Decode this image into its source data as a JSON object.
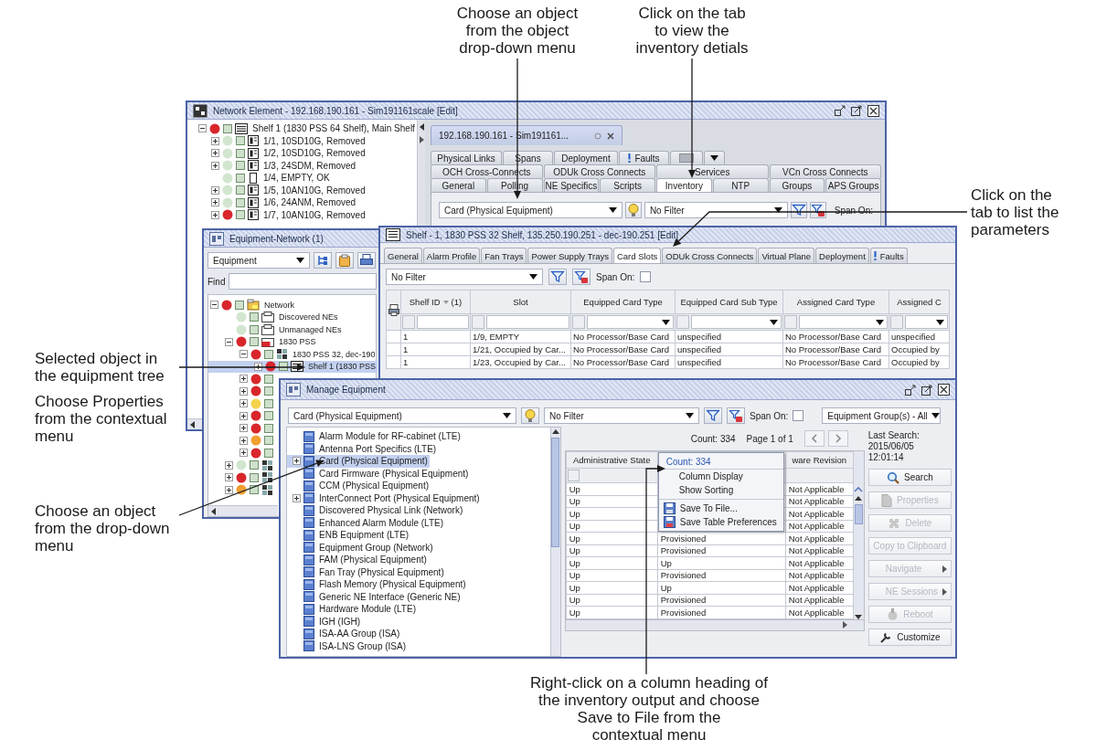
{
  "callouts": [
    {
      "lines": [
        "Choose an object",
        "from the object",
        "drop-down menu"
      ]
    },
    {
      "lines": [
        "Click on the tab",
        "to view the",
        "inventory detials"
      ]
    },
    {
      "lines": [
        "Click on the",
        "tab to list the",
        "parameters"
      ]
    },
    {
      "lines": [
        "Selected object in",
        "the equipment tree"
      ]
    },
    {
      "lines": [
        "Choose Properties",
        "from the contextual",
        "menu"
      ]
    },
    {
      "lines": [
        "Choose an object",
        "from the drop-down",
        "menu"
      ]
    },
    {
      "lines": [
        "Right-click on a column heading of",
        "the inventory output and choose",
        "Save to File from the",
        "contextual menu"
      ]
    }
  ],
  "network_element_window": {
    "title": "Network Element - 192.168.190.161 - Sim191161scale [Edit]",
    "tree": [
      {
        "label": "Shelf 1 (1830 PSS 64 Shelf), Main Shelf",
        "color": "#d8262b",
        "kind": "shelf",
        "expanded": true,
        "children": [
          {
            "label": "1/1, 10SD10G, Removed",
            "color": "#d2e6cf",
            "kind": "card",
            "expanded": false
          },
          {
            "label": "1/2, 10SD10G, Removed",
            "color": "#d2e6cf",
            "kind": "card",
            "expanded": false
          },
          {
            "label": "1/3, 24SDM, Removed",
            "color": "#d2e6cf",
            "kind": "card",
            "expanded": false
          },
          {
            "label": "1/4, EMPTY, OK",
            "color": "#d2e6cf",
            "kind": "slot"
          },
          {
            "label": "1/5, 10AN10G, Removed",
            "color": "#d2e6cf",
            "kind": "card",
            "expanded": false
          },
          {
            "label": "1/6, 24ANM, Removed",
            "color": "#d2e6cf",
            "kind": "card",
            "expanded": false
          },
          {
            "label": "1/7, 10AN10G, Removed",
            "color": "#d8262b",
            "kind": "card",
            "expanded": false
          }
        ]
      }
    ],
    "document_tab": "192.168.190.161 - Sim191161...",
    "tab_rows": [
      [
        {
          "label": "Physical Links",
          "selected": false,
          "kind": "text"
        },
        {
          "label": "Spans",
          "selected": false,
          "kind": "text"
        },
        {
          "label": "Deployment",
          "selected": false,
          "kind": "text"
        },
        {
          "label": "Faults",
          "selected": false,
          "kind": "alert"
        },
        {
          "selected": false,
          "kind": "icon"
        }
      ],
      [
        {
          "label": "OCH Cross-Connects",
          "selected": false,
          "kind": "text"
        },
        {
          "label": "ODUk Cross Connects",
          "selected": false,
          "kind": "text"
        },
        {
          "label": "Services",
          "selected": false,
          "kind": "text"
        },
        {
          "label": "VCn Cross Connects",
          "selected": false,
          "kind": "text"
        }
      ],
      [
        {
          "label": "General",
          "selected": false,
          "kind": "text"
        },
        {
          "label": "Polling",
          "selected": false,
          "kind": "text"
        },
        {
          "label": "NE Specifics",
          "selected": false,
          "kind": "text"
        },
        {
          "label": "Scripts",
          "selected": false,
          "kind": "text"
        },
        {
          "label": "Inventory",
          "selected": true,
          "kind": "text"
        },
        {
          "label": "NTP",
          "selected": false,
          "kind": "text"
        },
        {
          "label": "Groups",
          "selected": false,
          "kind": "text"
        },
        {
          "label": "APS Groups",
          "selected": false,
          "kind": "text"
        }
      ]
    ],
    "overflow_menu": true,
    "object_combo": "Card (Physical Equipment)",
    "filter_combo": "No Filter",
    "span_on_label": "Span On:"
  },
  "equipment_network_window": {
    "title": "Equipment-Network (1)",
    "view_combo": "Equipment",
    "find_label": "Find",
    "tree": [
      {
        "label": "Network",
        "color": "#d8262b",
        "kind": "network",
        "expanded": true,
        "selected": false,
        "children": [
          {
            "label": "Discovered NEs",
            "color": "#d2e6cf",
            "kind": "group",
            "selected": false
          },
          {
            "label": "Unmanaged NEs",
            "color": "#d2e6cf",
            "kind": "group",
            "selected": false
          },
          {
            "label": "1830 PSS",
            "color": "#d8262b",
            "kind": "ne",
            "expanded": true,
            "selected": false,
            "children": [
              {
                "label": "1830 PSS 32, dec-190",
                "color": "#d8262b",
                "kind": "node",
                "expanded": true,
                "selected": false,
                "children": [
                  {
                    "label": "Shelf 1 (1830 PSS",
                    "color": "#d8262b",
                    "kind": "shelf",
                    "expanded": false,
                    "selected": true
                  }
                ]
              },
              {
                "color": "#d8262b",
                "expanded": false,
                "selected": false
              },
              {
                "color": "#d8262b",
                "expanded": false,
                "selected": false
              },
              {
                "color": "#f3d34a",
                "expanded": false,
                "selected": false
              },
              {
                "color": "#d8262b",
                "expanded": false,
                "selected": false
              },
              {
                "color": "#d8262b",
                "expanded": false,
                "selected": false
              },
              {
                "color": "#f0a030",
                "expanded": false,
                "selected": false
              },
              {
                "color": "#d8262b",
                "expanded": false,
                "selected": false
              }
            ]
          },
          {
            "color": "#d2e6cf",
            "kind": "node",
            "expanded": false,
            "selected": false
          },
          {
            "color": "#d8262b",
            "kind": "node",
            "expanded": false,
            "selected": false
          },
          {
            "color": "#f0a030",
            "kind": "node",
            "expanded": false,
            "selected": false
          }
        ]
      }
    ]
  },
  "shelf_window": {
    "title": "Shelf - 1, 1830 PSS 32 Shelf, 135.250.190.251 - dec-190.251 [Edit]",
    "tabs": [
      {
        "label": "General",
        "selected": false,
        "kind": "text"
      },
      {
        "label": "Alarm Profile",
        "selected": false,
        "kind": "text"
      },
      {
        "label": "Fan Trays",
        "selected": false,
        "kind": "text"
      },
      {
        "label": "Power Supply Trays",
        "selected": false,
        "kind": "text"
      },
      {
        "label": "Card Slots",
        "selected": true,
        "kind": "text"
      },
      {
        "label": "ODUk Cross Connects",
        "selected": false,
        "kind": "text"
      },
      {
        "label": "Virtual Plane",
        "selected": false,
        "kind": "text"
      },
      {
        "label": "Deployment",
        "selected": false,
        "kind": "text"
      },
      {
        "label": "Faults",
        "selected": false,
        "kind": "alert"
      }
    ],
    "filter_combo": "No Filter",
    "span_on": {
      "label": "Span On:",
      "checked": false
    },
    "table": {
      "columns": [
        {
          "label": "Shelf ID",
          "sort_order": "(1)",
          "kind": "text"
        },
        {
          "label": "Slot",
          "kind": "text"
        },
        {
          "label": "Equipped Card Type",
          "kind": "choice"
        },
        {
          "label": "Equipped Card Sub Type",
          "kind": "choice"
        },
        {
          "label": "Assigned Card Type",
          "kind": "choice"
        },
        {
          "label": "Assigned C",
          "kind": "choice"
        }
      ],
      "rows": [
        [
          "1",
          "1/9, EMPTY",
          "No Processor/Base Card",
          "unspecified",
          "No Processor/Base Card",
          "unspecified"
        ],
        [
          "1",
          "1/21, Occupied by Car...",
          "No Processor/Base Card",
          "unspecified",
          "No Processor/Base Card",
          "Occupied by"
        ],
        [
          "1",
          "1/23, Occupied by Car...",
          "No Processor/Base Card",
          "unspecified",
          "No Processor/Base Card",
          "Occupied by"
        ]
      ]
    }
  },
  "manage_equipment_window": {
    "title": "Manage Equipment",
    "object_combo": "Card (Physical Equipment)",
    "filter_combo": "No Filter",
    "span_on": {
      "label": "Span On:",
      "checked": false
    },
    "group_combo": "Equipment Group(s) - All",
    "object_list": [
      {
        "label": "Alarm Module for RF-cabinet (LTE)",
        "selected": false
      },
      {
        "label": "Antenna Port Specifics (LTE)",
        "selected": false
      },
      {
        "label": "Card (Physical Equipment)",
        "selected": true,
        "expanded": false
      },
      {
        "label": "Card Firmware (Physical Equipment)",
        "selected": false
      },
      {
        "label": "CCM (Physical Equipment)",
        "selected": false
      },
      {
        "label": "InterConnect Port (Physical Equipment)",
        "selected": false,
        "expanded": false
      },
      {
        "label": "Discovered Physical Link (Network)",
        "selected": false
      },
      {
        "label": "Enhanced Alarm Module (LTE)",
        "selected": false
      },
      {
        "label": "ENB Equipment (LTE)",
        "selected": false
      },
      {
        "label": "Equipment Group (Network)",
        "selected": false
      },
      {
        "label": "FAM (Physical Equipment)",
        "selected": false
      },
      {
        "label": "Fan Tray (Physical Equipment)",
        "selected": false
      },
      {
        "label": "Flash Memory (Physical Equipment)",
        "selected": false
      },
      {
        "label": "Generic NE Interface (Generic NE)",
        "selected": false
      },
      {
        "label": "Hardware Module (LTE)",
        "selected": false
      },
      {
        "label": "IGH (IGH)",
        "selected": false
      },
      {
        "label": "ISA-AA Group (ISA)",
        "selected": false
      },
      {
        "label": "ISA-LNS Group (ISA)",
        "selected": false
      }
    ],
    "count": "Count: 334",
    "page": "Page 1 of 1",
    "table": {
      "headings": {
        "administrative_state": "Administrative State",
        "column_3": "ware Revision"
      },
      "rows": [
        {
          "administrative_state": "Up",
          "column_3": "Not Applicable"
        },
        {
          "administrative_state": "Up",
          "column_3": "Not Applicable"
        },
        {
          "administrative_state": "Up",
          "column_3": "Not Applicable"
        },
        {
          "administrative_state": "Up",
          "column_3": "Not Applicable"
        },
        {
          "administrative_state": "Up",
          "column_2": "Provisioned",
          "column_3": "Not Applicable"
        },
        {
          "administrative_state": "Up",
          "column_2": "Provisioned",
          "column_3": "Not Applicable"
        },
        {
          "administrative_state": "Up",
          "column_2": "Up",
          "column_3": "Not Applicable"
        },
        {
          "administrative_state": "Up",
          "column_2": "Provisioned",
          "column_3": "Not Applicable"
        },
        {
          "administrative_state": "Up",
          "column_2": "Up",
          "column_3": "Not Applicable"
        },
        {
          "administrative_state": "Up",
          "column_2": "Provisioned",
          "column_3": "Not Applicable"
        },
        {
          "administrative_state": "Up",
          "column_2": "Provisioned",
          "column_3": "Not Applicable"
        }
      ]
    },
    "last_search_label": "Last Search:",
    "last_search_time": "2015/06/05 12:01:14",
    "buttons": [
      {
        "label": "Search",
        "kind": "search",
        "disabled": false
      },
      {
        "label": "Properties",
        "kind": "properties",
        "disabled": true
      },
      {
        "label": "Delete",
        "kind": "delete",
        "disabled": true
      },
      {
        "label": "Copy to Clipboard",
        "kind": "copy",
        "disabled": true
      },
      {
        "label": "Navigate",
        "kind": "navigate",
        "disabled": true
      },
      {
        "label": "NE Sessions",
        "kind": "sessions",
        "disabled": true
      },
      {
        "label": "Reboot",
        "kind": "reboot",
        "disabled": true
      },
      {
        "label": "Customize",
        "kind": "customize",
        "disabled": false
      }
    ],
    "context_menu": {
      "header": "Count: 334",
      "items": [
        {
          "label": "Column Display",
          "kind": "plain"
        },
        {
          "label": "Show Sorting",
          "kind": "plain"
        },
        {
          "label": "Save To File...",
          "kind": "save"
        },
        {
          "label": "Save Table Preferences",
          "kind": "save-prefs"
        }
      ]
    }
  }
}
